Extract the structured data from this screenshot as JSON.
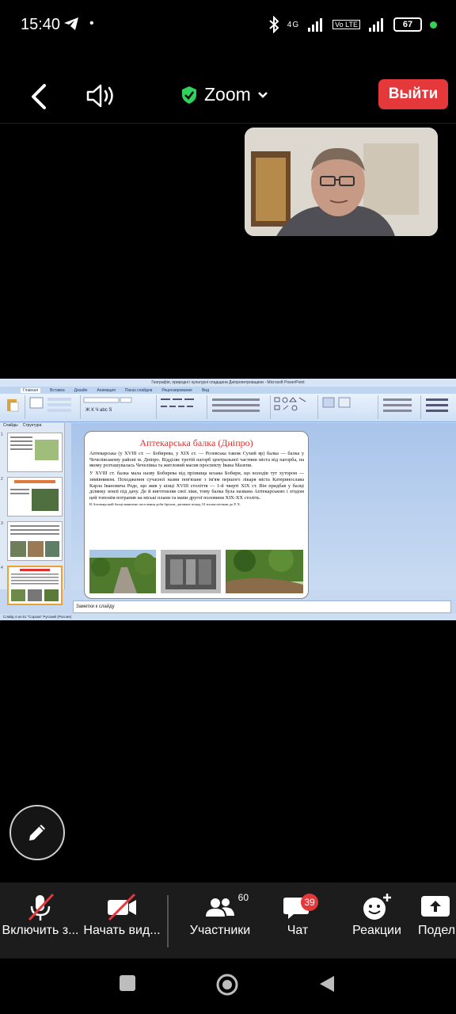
{
  "status_bar": {
    "time": "15:40",
    "network": "4G",
    "volte": "Vo LTE",
    "battery": "67"
  },
  "top_bar": {
    "app_title": "Zoom",
    "leave_label": "Выйти"
  },
  "shared_screen": {
    "window_title": "Географія, природні і культурні спадщини Дніпропетровщини - Microsoft PowerPoint",
    "ribbon_tabs": [
      "Главная",
      "Вставка",
      "Дизайн",
      "Анимация",
      "Показ слайдов",
      "Рецензирование",
      "Вид"
    ],
    "panel_tabs": [
      "Слайды",
      "Структура"
    ],
    "slide_numbers": [
      "1",
      "2",
      "3",
      "4"
    ],
    "slide": {
      "title": "Аптекарська балка (Дніпро)",
      "paragraph1": "Аптекарська (у XVIII ст. — Бобирева, у XIX ст. — Розевська також Сухий яр) балка — балка у Чечелівському районі м. Дніпро. Відділяє третій пагорб центральної частини міста від пагорба, на якому розташувалась Чечелівка та житловий масив проспекту Івана Мазепи.",
      "paragraph2": "У XVIII ст. балка мала назву Бобирева від прізвища козака Бобири, що володів тут хутором — зимівником. Походження сучасної назви пов'язане з ім'ям першого лікаря міста Катеринослава Карла Івановича Роде, що жив у кінці XVIII століття — 1-й чверті XIX ст. Він придбав у балці ділянку землі під дачу. Де й виготовляв свої ліки, тому балка була названа Аптекарською і згодом цей топонім потрапив на міські плани та мапи другої половини XIX-XX століть.",
      "footnote": "В Аптекарській балці виявлено поселення доби бронзи, датоване понад 10 тисячоліттями до Р. Х."
    },
    "notes_placeholder": "Заметки к слайду",
    "status_text": "Слайд 4 из 51   \"Сорока\"   Русский (Россия)"
  },
  "toolbar": {
    "mute_label": "Включить з...",
    "video_label": "Начать вид...",
    "participants_label": "Участники",
    "participants_count": "60",
    "chat_label": "Чат",
    "chat_badge": "39",
    "reactions_label": "Реакции",
    "share_label": "Подел"
  },
  "colors": {
    "leave_button": "#e5383b",
    "secure_shield": "#2fd35b",
    "toolbar_bg": "#1c1c1c"
  }
}
